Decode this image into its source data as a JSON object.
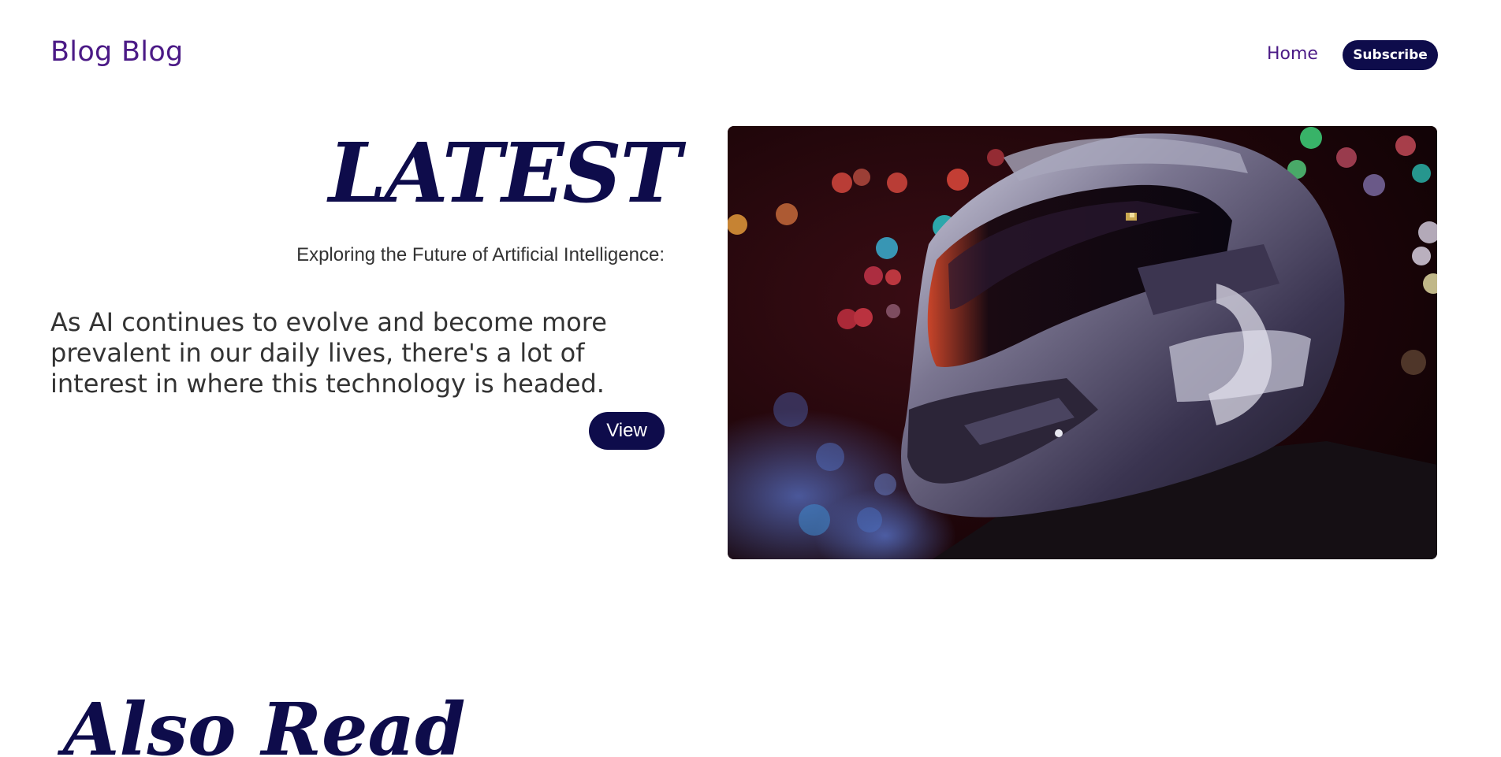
{
  "header": {
    "brand": "Blog Blog",
    "nav_home": "Home",
    "subscribe_label": "Subscribe"
  },
  "hero": {
    "heading": "LATEST",
    "subtitle": "Exploring the Future of Artificial Intelligence:",
    "excerpt": "As AI continues to evolve and become more prevalent in our daily lives, there's a lot of interest in where this technology is headed.",
    "view_label": "View",
    "image_icon": "futuristic-helmet-image"
  },
  "also_read": {
    "heading": "Also Read"
  },
  "colors": {
    "brand_purple": "#4b1a86",
    "navy": "#0e0c4b",
    "body_text": "#333333",
    "background": "#ffffff"
  }
}
